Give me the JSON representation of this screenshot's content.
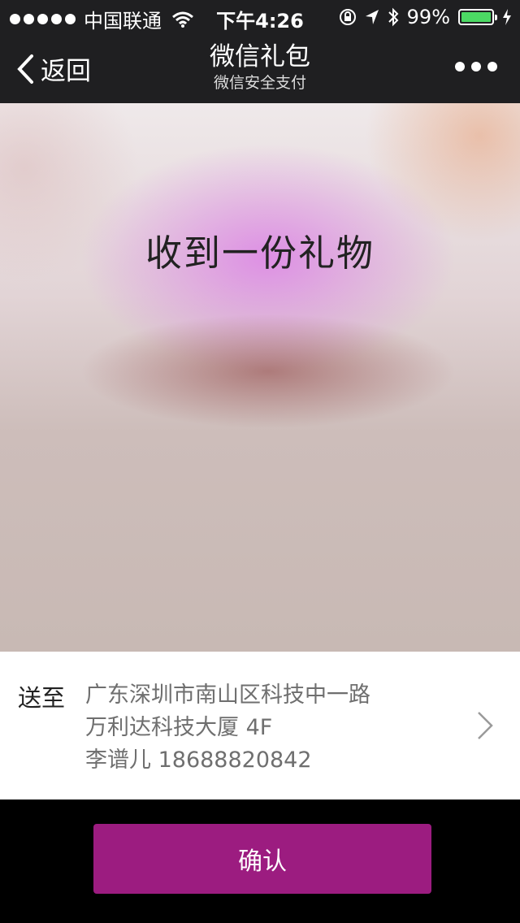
{
  "status_bar": {
    "carrier": "中国联通",
    "time": "下午4:26",
    "battery_percent": "99%",
    "battery_level": 0.99,
    "battery_color": "#4cd964"
  },
  "nav": {
    "back_label": "返回",
    "title": "微信礼包",
    "subtitle": "微信安全支付",
    "more_icon": "more-icon"
  },
  "gift": {
    "title": "收到一份礼物"
  },
  "address": {
    "label": "送至",
    "line1": "广东深圳市南山区科技中一路",
    "line2": "万利达科技大厦 4F",
    "recipient": "李谱儿 18688820842"
  },
  "actions": {
    "confirm_label": "确认",
    "confirm_color": "#9c1c80"
  }
}
